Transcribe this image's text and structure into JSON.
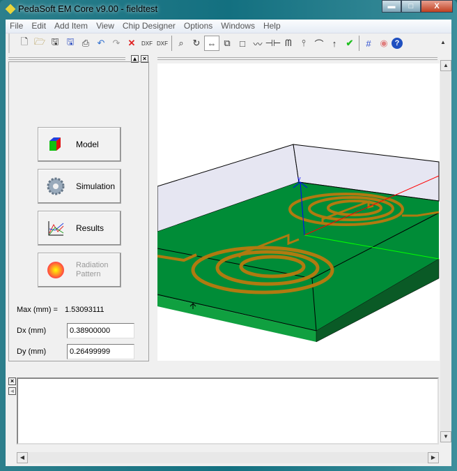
{
  "window": {
    "title": "PedaSoft EM Core v9.00 - fieldtest",
    "minimize": "▬",
    "maximize": "□",
    "close": "X"
  },
  "menu": [
    "File",
    "Edit",
    "Add Item",
    "View",
    "Chip Designer",
    "Options",
    "Windows",
    "Help"
  ],
  "toolbar": [
    "new-file",
    "open-folder",
    "save",
    "save-all",
    "print",
    "undo",
    "redo",
    "delete",
    "import-dxf",
    "export-dxf",
    "zoom",
    "rotate",
    "pan",
    "box-3d",
    "rectangle",
    "resistor",
    "capacitor",
    "inductor",
    "port",
    "arc",
    "arrow-up",
    "check",
    "grid",
    "stop",
    "help"
  ],
  "side": {
    "buttons": {
      "model": "Model",
      "simulation": "Simulation",
      "results": "Results",
      "radiation_line1": "Radiation",
      "radiation_line2": "Pattern"
    },
    "max_label": "Max (mm) =",
    "max_value": "1.53093111",
    "dx_label": "Dx (mm)",
    "dx_value": "0.38900000",
    "dy_label": "Dy (mm)",
    "dy_value": "0.26499999"
  },
  "view": {
    "axis_label": "y",
    "colors": {
      "board": "#008c37",
      "wall": "#e6e6f2",
      "trace": "#b07a10",
      "x_axis": "#ff0000",
      "y_axis": "#0000ff",
      "z_axis": "#00ff00"
    }
  }
}
